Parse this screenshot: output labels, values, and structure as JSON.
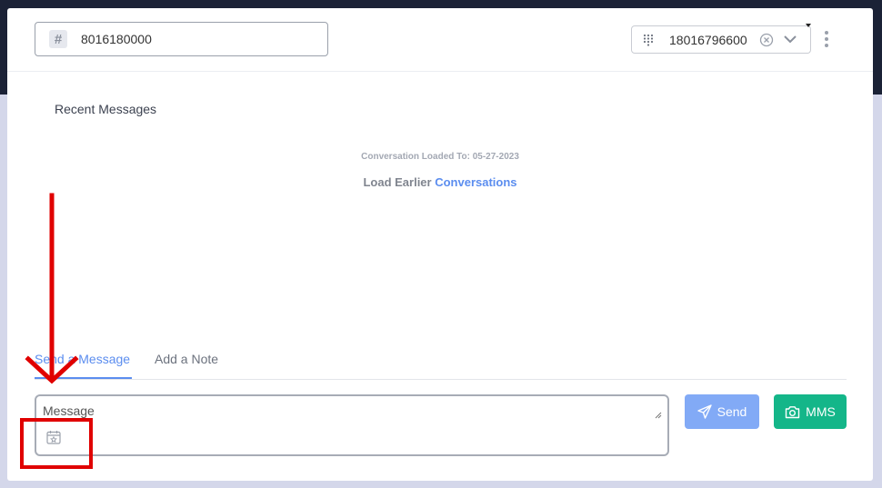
{
  "header": {
    "number_value": "8016180000",
    "phone_select_value": "18016796600",
    "icons": {
      "number": "hash-icon",
      "phone": "dialpad-icon",
      "clear": "clear-icon",
      "dropdown": "chevron-down-icon",
      "menu": "kebab-menu-icon"
    }
  },
  "messages": {
    "section_title": "Recent Messages",
    "loaded_to": "Conversation Loaded To: 05-27-2023",
    "load_earlier_prefix": "Load Earlier",
    "load_earlier_link": "Conversations"
  },
  "composer": {
    "tabs": [
      {
        "label": "Send a Message",
        "active": true
      },
      {
        "label": "Add a Note",
        "active": false
      }
    ],
    "placeholder": "Message",
    "send_label": "Send",
    "mms_label": "MMS",
    "icons": {
      "schedule": "calendar-icon",
      "send": "paper-plane-icon",
      "mms": "camera-icon"
    }
  },
  "colors": {
    "accent": "#5b8def",
    "send_button": "#82aaf6",
    "mms_button": "#14b689",
    "annotation": "#e00000",
    "topbar": "#1b2236"
  }
}
